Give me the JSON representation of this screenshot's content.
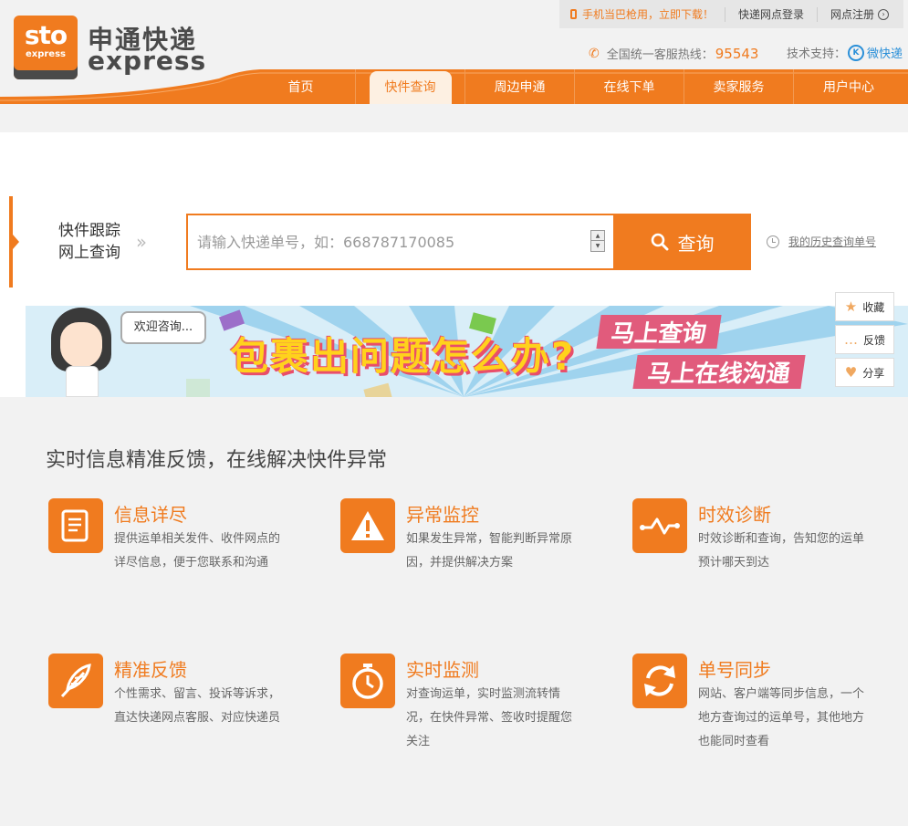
{
  "brand": {
    "logo_main": "sto",
    "logo_sub": "express",
    "name_cn": "申通快递",
    "name_en": "express"
  },
  "topbar": {
    "promo": "手机当巴枪用，立即下载！",
    "login": "快递网点登录",
    "register": "网点注册"
  },
  "hotline": {
    "label": "全国统一客服热线：",
    "number": "95543"
  },
  "support": {
    "label": "技术支持：",
    "vendor": "微快递"
  },
  "nav": {
    "items": [
      {
        "label": "首页"
      },
      {
        "label": "快件查询"
      },
      {
        "label": "周边申通"
      },
      {
        "label": "在线下单"
      },
      {
        "label": "卖家服务"
      },
      {
        "label": "用户中心"
      }
    ],
    "active_index": 1
  },
  "search": {
    "label_line1": "快件跟踪",
    "label_line2": "网上查询",
    "placeholder": "请输入快递单号，如：668787170085",
    "value": "",
    "button_label": "查询",
    "history_link": "我的历史查询单号"
  },
  "banner": {
    "bubble": "欢迎咨询...",
    "headline": "包裹出问题怎么办?",
    "tag1": "马上查询",
    "tag2": "马上在线沟通"
  },
  "side_tools": [
    {
      "label": "收藏",
      "icon": "star-icon",
      "glyph": "★"
    },
    {
      "label": "反馈",
      "icon": "chat-icon",
      "glyph": "…"
    },
    {
      "label": "分享",
      "icon": "heart-icon",
      "glyph": "♥"
    }
  ],
  "features": {
    "title": "实时信息精准反馈，在线解决快件异常",
    "items": [
      {
        "name": "信息详尽",
        "icon": "document-icon",
        "desc": "提供运单相关发件、收件网点的详尽信息，便于您联系和沟通"
      },
      {
        "name": "异常监控",
        "icon": "warning-icon",
        "desc": "如果发生异常，智能判断异常原因，并提供解决方案"
      },
      {
        "name": "时效诊断",
        "icon": "pulse-icon",
        "desc": "时效诊断和查询，告知您的运单预计哪天到达"
      },
      {
        "name": "精准反馈",
        "icon": "feather-icon",
        "desc": "个性需求、留言、投诉等诉求，直达快递网点客服、对应快递员"
      },
      {
        "name": "实时监测",
        "icon": "stopwatch-icon",
        "desc": "对查询运单，实时监测流转情况，在快件异常、签收时提醒您关注"
      },
      {
        "name": "单号同步",
        "icon": "sync-icon",
        "desc": "网站、客户端等同步信息，一个地方查询过的运单号，其他地方也能同时查看"
      }
    ]
  },
  "colors": {
    "brand_orange": "#f07b1f",
    "text_dark": "#333333",
    "background": "#f2f2f2"
  }
}
